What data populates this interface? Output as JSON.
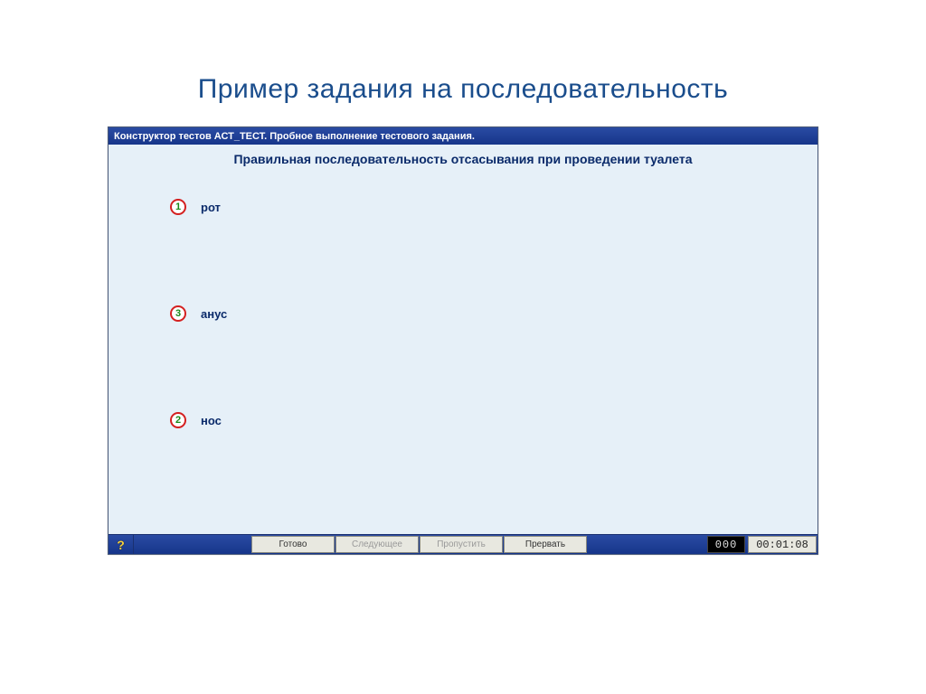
{
  "slide": {
    "heading": "Пример задания на последовательность"
  },
  "window": {
    "title": "Конструктор тестов АСТ_ТЕСТ. Пробное выполнение тестового задания."
  },
  "question": {
    "text": "Правильная последовательность отсасывания при проведении туалета"
  },
  "answers": [
    {
      "number": "1",
      "label": "рот"
    },
    {
      "number": "3",
      "label": "анус"
    },
    {
      "number": "2",
      "label": "нос"
    }
  ],
  "toolbar": {
    "help_hint": "?",
    "ready_label": "Готово",
    "next_label": "Следующее",
    "skip_label": "Пропустить",
    "abort_label": "Прервать"
  },
  "status": {
    "counter": "000",
    "timer": "00:01:08"
  }
}
